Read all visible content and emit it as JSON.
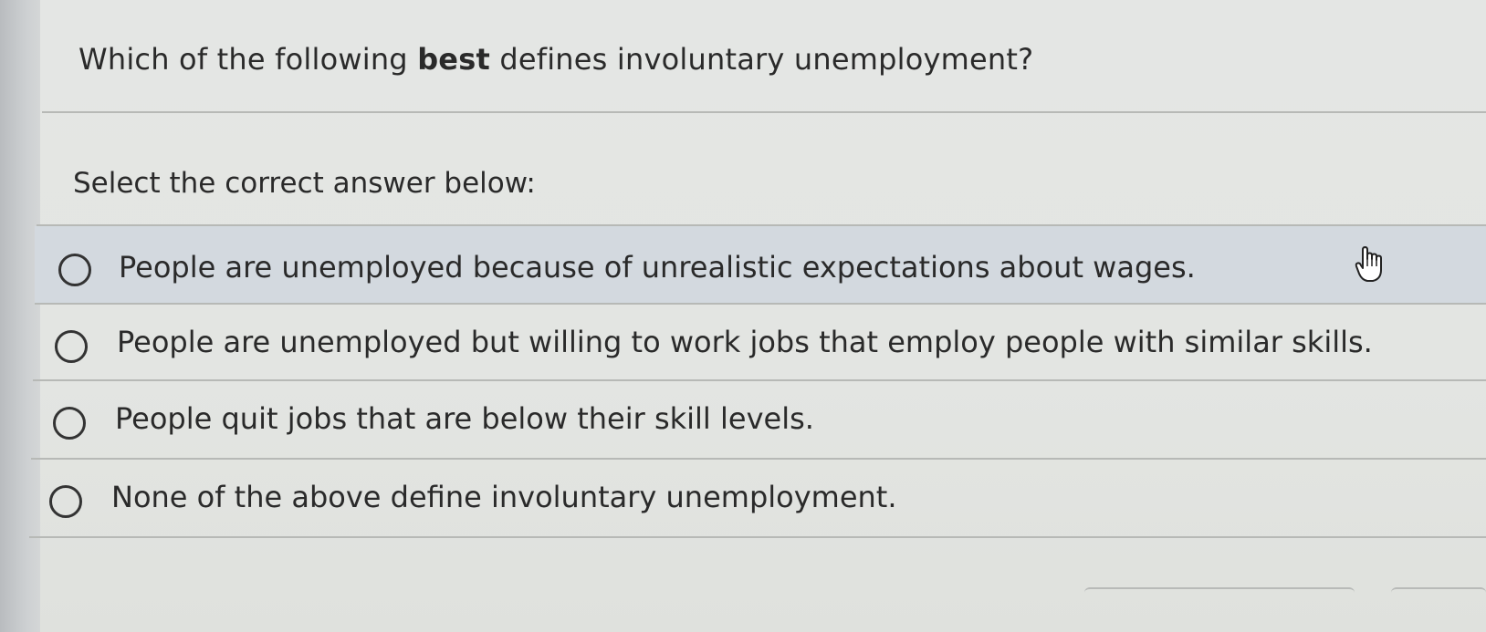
{
  "question": {
    "prefix": "Which of the following ",
    "emphasis": "best",
    "suffix": " defines involuntary unemployment?"
  },
  "instruction": "Select the correct answer below:",
  "options": [
    {
      "label": "People are unemployed because of unrealistic expectations about wages.",
      "selected": false
    },
    {
      "label": "People are unemployed but willing to work jobs that employ people with similar skills.",
      "selected": false
    },
    {
      "label": "People quit jobs that are below their skill levels.",
      "selected": false
    },
    {
      "label": "None of the above define involuntary unemployment.",
      "selected": false
    }
  ],
  "cursor_icon": "hand-pointer-icon",
  "colors": {
    "background": "#e3e5e2",
    "hover_row": "#d3d9df",
    "text": "#2a2a2a",
    "divider": "#b7b9b6"
  }
}
